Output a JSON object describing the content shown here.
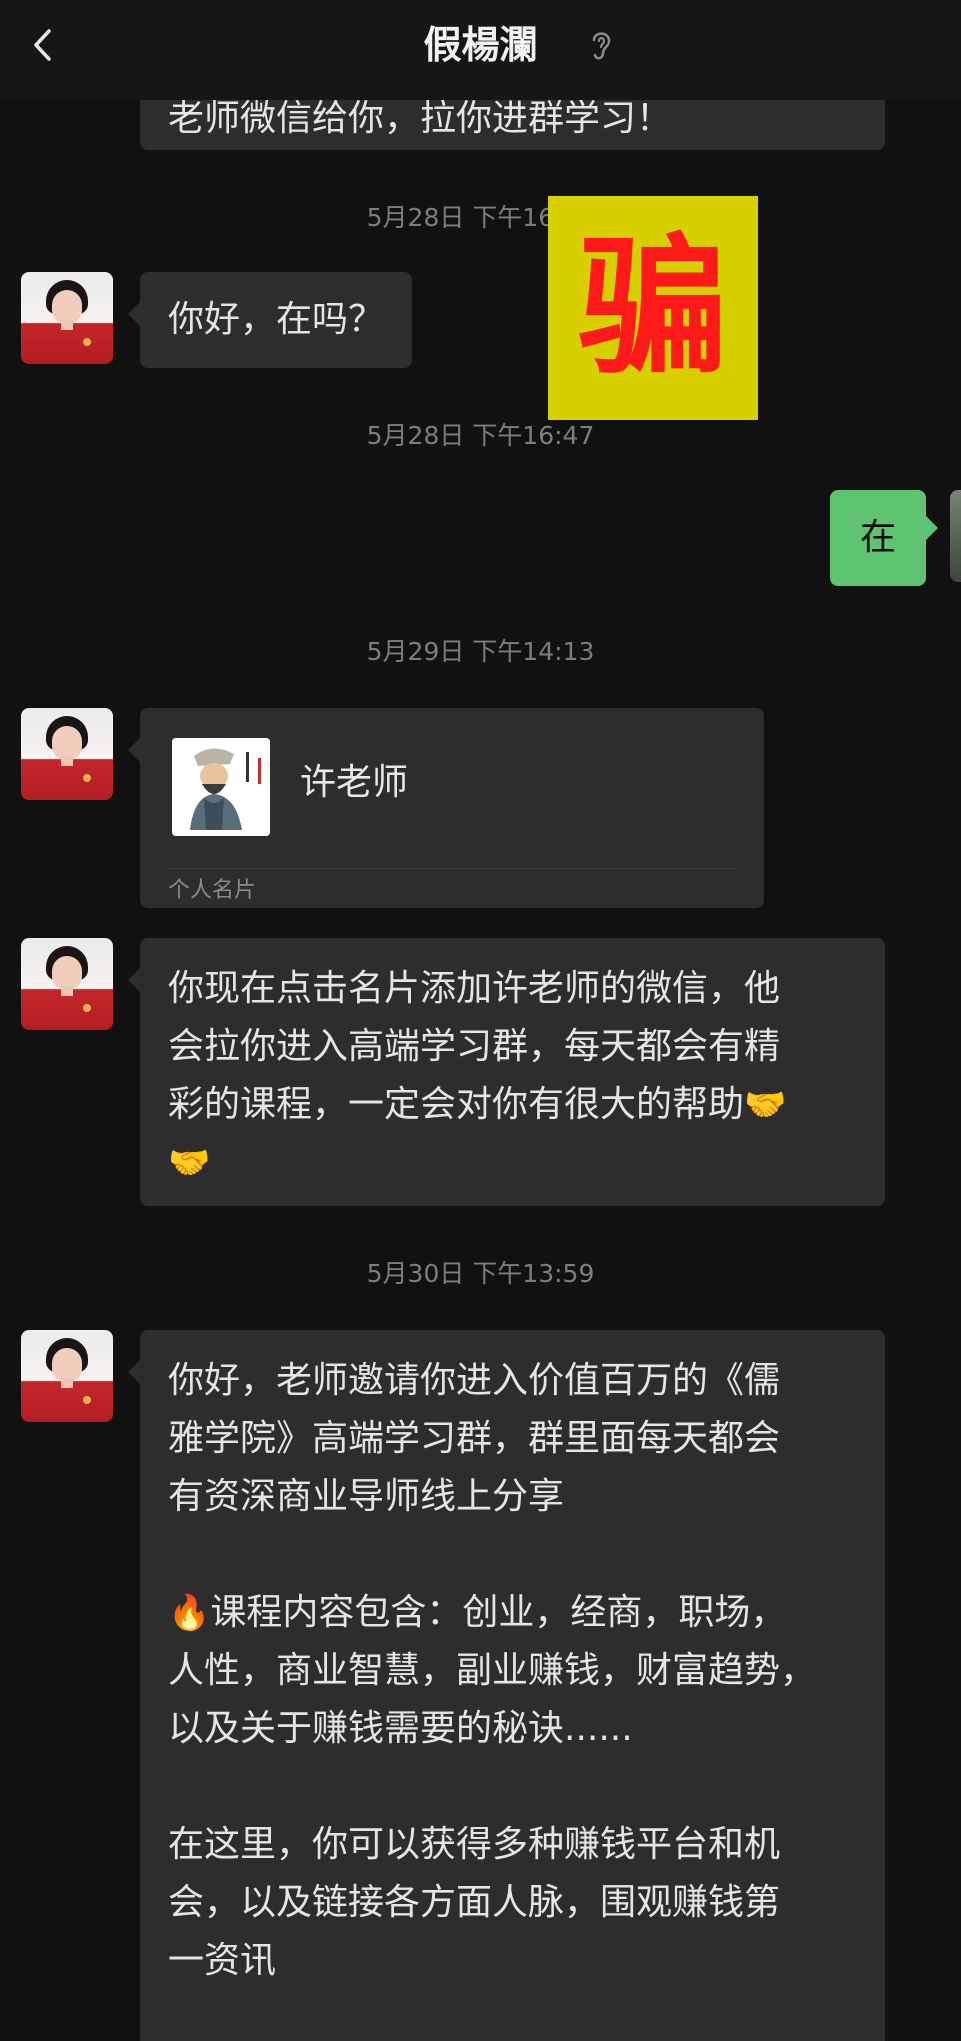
{
  "header": {
    "title": "假楊瀾",
    "back_icon": "chevron-left-icon",
    "ear_icon": "ear-icon"
  },
  "stamp": {
    "text": "骗",
    "bg_color": "#d8cf00",
    "text_color": "#ff1a1a"
  },
  "colors": {
    "background": "#111111",
    "bubble": "#2d2d2d",
    "self_bubble": "#5fc472"
  },
  "messages": {
    "m0": {
      "text": "老师微信给你，拉你进群学习！"
    },
    "t1": "5月28日 下午16:41",
    "m1": {
      "text": "你好，在吗？"
    },
    "t2": "5月28日 下午16:47",
    "m2": {
      "text": "在"
    },
    "t3": "5月29日 下午14:13",
    "m3": {
      "card_name": "许老师",
      "card_label": "个人名片"
    },
    "m4": {
      "line1": "你现在点击名片添加许老师的微信，他",
      "line2": "会拉你进入高端学习群，每天都会有精",
      "line3": "彩的课程，一定会对你有很大的帮助",
      "emoji": "🤝"
    },
    "t4": "5月30日 下午13:59",
    "m5": {
      "p1": "你好，老师邀请你进入价值百万的《儒\n雅学院》高端学习群，群里面每天都会\n有资深商业导师线上分享",
      "p2_emoji": "🔥",
      "p2": "课程内容包含：创业，经商，职场，\n人性，商业智慧，副业赚钱，财富趋势，\n以及关于赚钱需要的秘诀......",
      "p3": "在这里，你可以获得多种赚钱平台和机\n会，以及链接各方面人脉，围观赚钱第\n一资讯"
    }
  }
}
